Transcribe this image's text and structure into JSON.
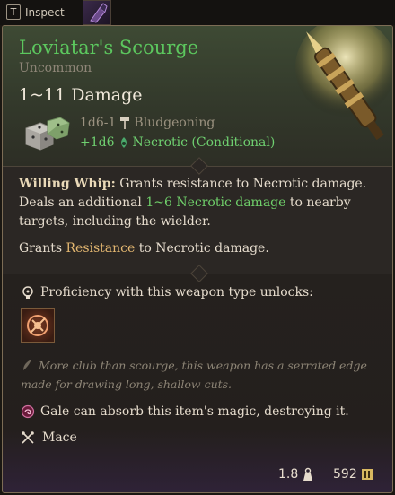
{
  "topbar": {
    "key": "T",
    "action": "Inspect"
  },
  "item": {
    "name": "Loviatar's Scourge",
    "rarity": "Uncommon",
    "damage": "1~11 Damage",
    "base_damage": "1d6-1",
    "base_type": "Bludgeoning",
    "bonus_damage": "+1d6",
    "bonus_type": "Necrotic (Conditional)"
  },
  "description": {
    "ability_name": "Willing Whip:",
    "ability_text_1": " Grants resistance to Necrotic damage. Deals an additional ",
    "ability_highlight": "1~6 Necrotic damage",
    "ability_text_2": " to nearby targets, including the wielder.",
    "grants_prefix": "Grants ",
    "grants_keyword": "Resistance",
    "grants_suffix": " to Necrotic damage."
  },
  "lower": {
    "proficiency": "Proficiency with this weapon type unlocks:",
    "flavor": "More club than scourge, this weapon has a serrated edge made for drawing long, shallow cuts.",
    "absorb": "Gale can absorb this item's magic, destroying it.",
    "weapon_type": "Mace"
  },
  "footer": {
    "weight": "1.8",
    "value": "592"
  },
  "colors": {
    "name": "#5cc75e",
    "necrotic": "#6fcf6a",
    "keyword": "#e2b670"
  },
  "icons": [
    "dice-icon",
    "hammer-icon",
    "necrotic-icon",
    "proficiency-icon",
    "weapon-action-icon",
    "flavor-icon",
    "gale-absorb-icon",
    "mace-icon",
    "weight-icon",
    "gold-icon"
  ]
}
